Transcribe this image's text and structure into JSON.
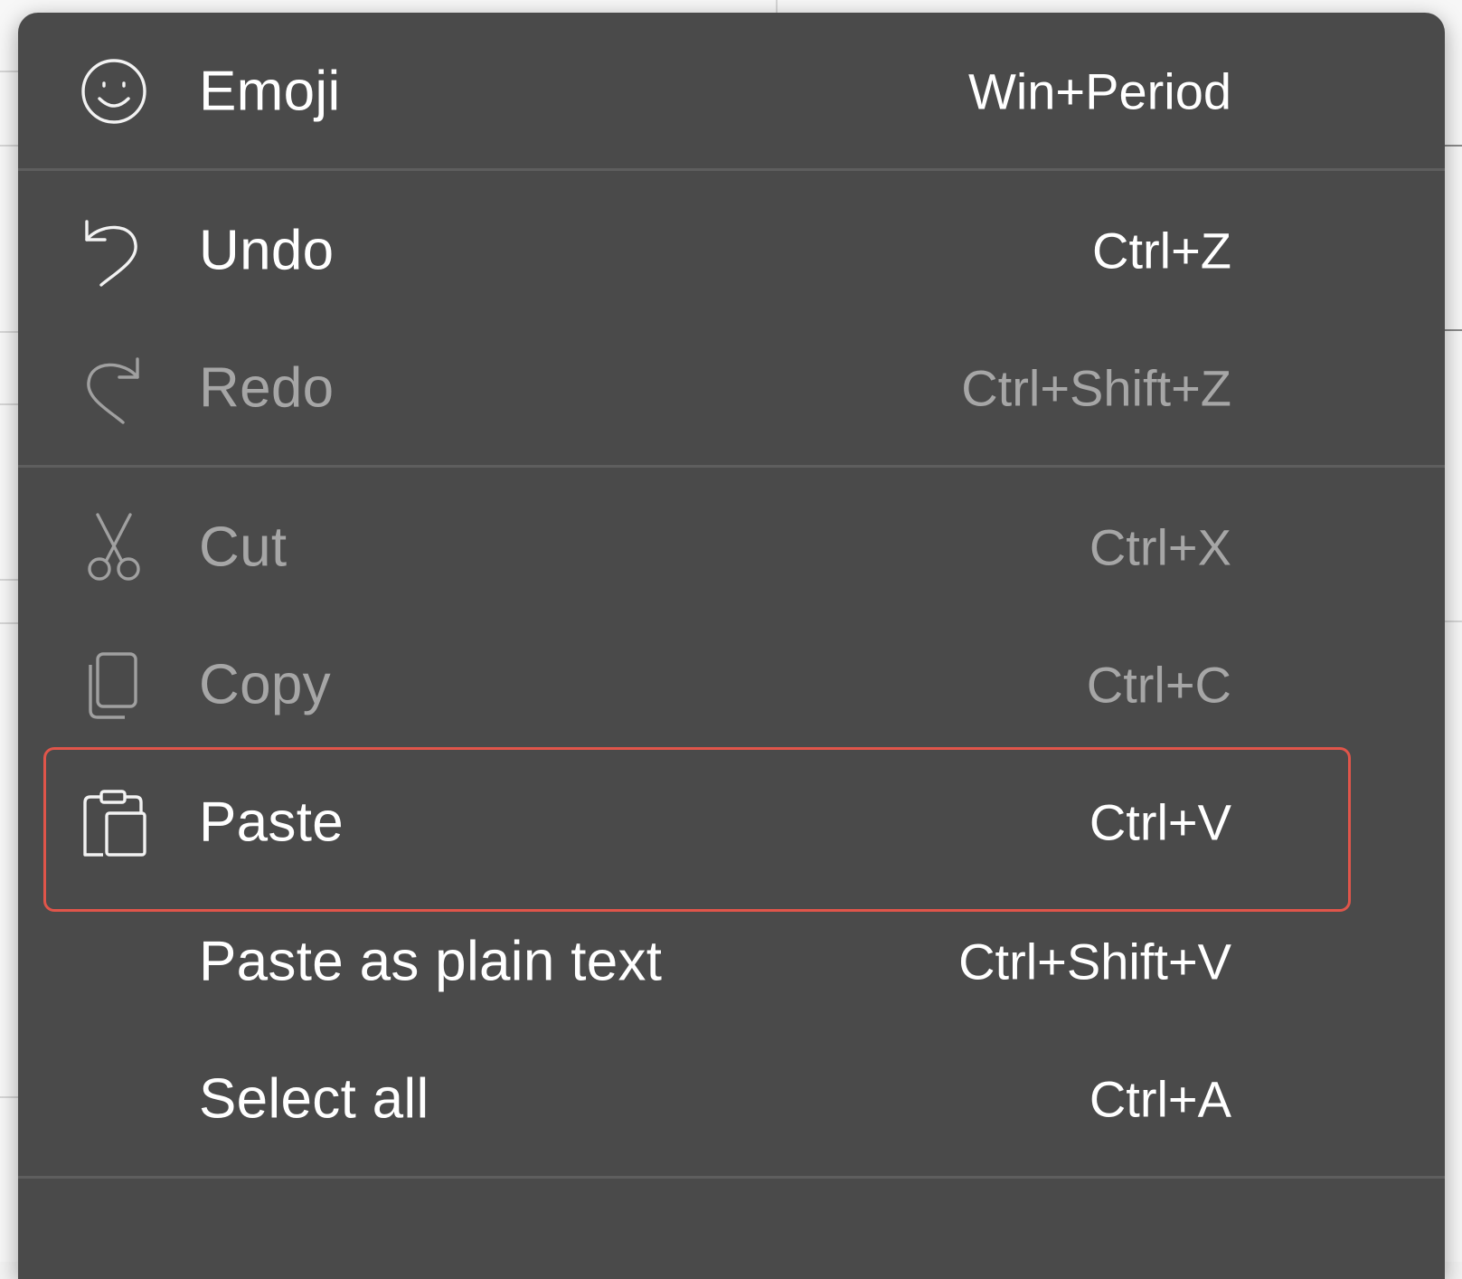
{
  "menu": {
    "items": [
      {
        "label": "Emoji",
        "shortcut": "Win+Period",
        "icon": "emoji-icon",
        "enabled": true
      },
      {
        "label": "Undo",
        "shortcut": "Ctrl+Z",
        "icon": "undo-icon",
        "enabled": true
      },
      {
        "label": "Redo",
        "shortcut": "Ctrl+Shift+Z",
        "icon": "redo-icon",
        "enabled": false
      },
      {
        "label": "Cut",
        "shortcut": "Ctrl+X",
        "icon": "scissors-icon",
        "enabled": false
      },
      {
        "label": "Copy",
        "shortcut": "Ctrl+C",
        "icon": "copy-icon",
        "enabled": false
      },
      {
        "label": "Paste",
        "shortcut": "Ctrl+V",
        "icon": "clipboard-icon",
        "enabled": true,
        "highlighted": true
      },
      {
        "label": "Paste as plain text",
        "shortcut": "Ctrl+Shift+V",
        "icon": null,
        "enabled": true
      },
      {
        "label": "Select all",
        "shortcut": "Ctrl+A",
        "icon": null,
        "enabled": true
      }
    ]
  },
  "colors": {
    "menu_background": "#4a4a4a",
    "enabled_text": "#ffffff",
    "disabled_text": "#a6a6a6",
    "highlight_border": "#e0554a",
    "separator": "#5e5e5e"
  }
}
